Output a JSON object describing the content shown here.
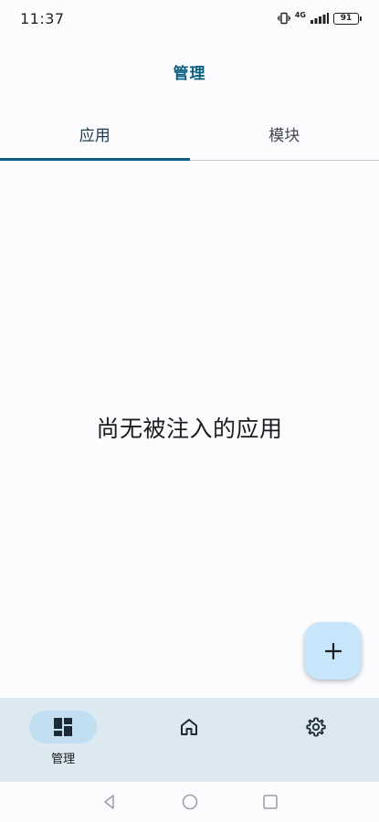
{
  "status_bar": {
    "time": "11:37",
    "network": "4G",
    "battery": "91",
    "icons": [
      "vibrate-icon",
      "signal-icon",
      "battery-icon"
    ]
  },
  "app_bar": {
    "title": "管理"
  },
  "tabs": [
    {
      "label": "应用",
      "active": true
    },
    {
      "label": "模块",
      "active": false
    }
  ],
  "empty_state": {
    "message": "尚无被注入的应用"
  },
  "fab": {
    "icon": "plus-icon"
  },
  "bottom_nav": [
    {
      "label": "管理",
      "icon": "dashboard-icon",
      "active": true
    },
    {
      "label": "",
      "icon": "home-icon",
      "active": false
    },
    {
      "label": "",
      "icon": "gear-icon",
      "active": false
    }
  ],
  "system_nav": {
    "icons": [
      "back-icon",
      "home-circle-icon",
      "recents-icon"
    ]
  },
  "colors": {
    "accent": "#0d5f82",
    "background": "#fcfcff",
    "nav_background": "#dde9f1",
    "fab_background": "#c8e6fb",
    "active_pill": "#c2dff2"
  }
}
